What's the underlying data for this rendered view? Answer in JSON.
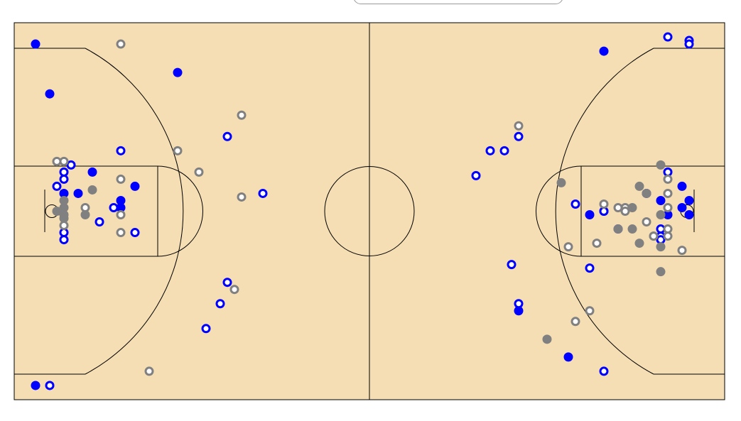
{
  "colors": {
    "court": "#f5deb3",
    "lines": "#000000",
    "team_a": "#0000ff",
    "team_b": "#808080"
  },
  "chart_data": {
    "type": "scatter",
    "title": "",
    "xlabel": "",
    "ylabel": "",
    "grid": false,
    "legend": "none",
    "xlim": [
      0,
      100
    ],
    "ylim": [
      0,
      53
    ],
    "series": [
      {
        "color": "#0000ff",
        "marker": "filled-circle",
        "points": [
          [
            3,
            50
          ],
          [
            5,
            43
          ],
          [
            23,
            46
          ],
          [
            11,
            32
          ],
          [
            17,
            30
          ],
          [
            9,
            29
          ],
          [
            15,
            28
          ],
          [
            7,
            29
          ],
          [
            15,
            27
          ],
          [
            3,
            2
          ],
          [
            83,
            49
          ],
          [
            94,
            30
          ],
          [
            89,
            29
          ],
          [
            91,
            28
          ],
          [
            95,
            28
          ],
          [
            94,
            27
          ],
          [
            95,
            26
          ],
          [
            81,
            26
          ],
          [
            83,
            26.5
          ],
          [
            85,
            24
          ],
          [
            92,
            26
          ],
          [
            78,
            6
          ],
          [
            71,
            12.5
          ]
        ]
      },
      {
        "color": "#0000ff",
        "marker": "open-circle",
        "points": [
          [
            5,
            2
          ],
          [
            15,
            35
          ],
          [
            30,
            37
          ],
          [
            35,
            29
          ],
          [
            8,
            33
          ],
          [
            7,
            32
          ],
          [
            6,
            30
          ],
          [
            7,
            31
          ],
          [
            14,
            27
          ],
          [
            12,
            25
          ],
          [
            17,
            23.5
          ],
          [
            7,
            23.5
          ],
          [
            7,
            22.5
          ],
          [
            30,
            16.5
          ],
          [
            29,
            13.5
          ],
          [
            27,
            10
          ],
          [
            92,
            51
          ],
          [
            95,
            50.5
          ],
          [
            95,
            50
          ],
          [
            71,
            37
          ],
          [
            67,
            35
          ],
          [
            69,
            35
          ],
          [
            65,
            31.5
          ],
          [
            92,
            32
          ],
          [
            79,
            27.5
          ],
          [
            83,
            26.5
          ],
          [
            91,
            24
          ],
          [
            91,
            23
          ],
          [
            91,
            22.5
          ],
          [
            70,
            19
          ],
          [
            81,
            18.5
          ],
          [
            71,
            13.5
          ],
          [
            83,
            4
          ]
        ]
      },
      {
        "color": "#808080",
        "marker": "filled-circle",
        "points": [
          [
            11,
            29.5
          ],
          [
            7,
            28
          ],
          [
            7,
            27
          ],
          [
            10,
            26
          ],
          [
            6,
            26.5
          ],
          [
            7,
            26
          ],
          [
            7,
            25.5
          ],
          [
            91,
            33
          ],
          [
            77,
            30.5
          ],
          [
            88,
            30
          ],
          [
            89,
            29
          ],
          [
            87,
            27
          ],
          [
            91,
            26
          ],
          [
            87,
            24
          ],
          [
            85,
            24
          ],
          [
            88,
            22
          ],
          [
            91,
            21.5
          ],
          [
            91,
            18
          ],
          [
            75,
            8.5
          ]
        ]
      },
      {
        "color": "#808080",
        "marker": "open-circle",
        "points": [
          [
            15,
            50
          ],
          [
            32,
            40
          ],
          [
            23,
            35
          ],
          [
            26,
            32
          ],
          [
            15,
            31
          ],
          [
            6,
            33.5
          ],
          [
            7,
            33.5
          ],
          [
            32,
            28.5
          ],
          [
            10,
            27
          ],
          [
            15,
            26
          ],
          [
            7,
            24.5
          ],
          [
            15,
            23.5
          ],
          [
            31,
            15.5
          ],
          [
            19,
            4
          ],
          [
            71,
            38.5
          ],
          [
            83,
            27.5
          ],
          [
            86,
            27
          ],
          [
            85,
            27
          ],
          [
            86,
            26.5
          ],
          [
            92,
            31
          ],
          [
            92,
            29
          ],
          [
            92,
            27
          ],
          [
            89,
            25
          ],
          [
            92,
            24
          ],
          [
            90,
            23
          ],
          [
            92,
            23
          ],
          [
            90,
            23
          ],
          [
            82,
            22
          ],
          [
            78,
            21.5
          ],
          [
            94,
            21
          ],
          [
            81,
            12.5
          ],
          [
            79,
            11
          ]
        ]
      }
    ]
  }
}
